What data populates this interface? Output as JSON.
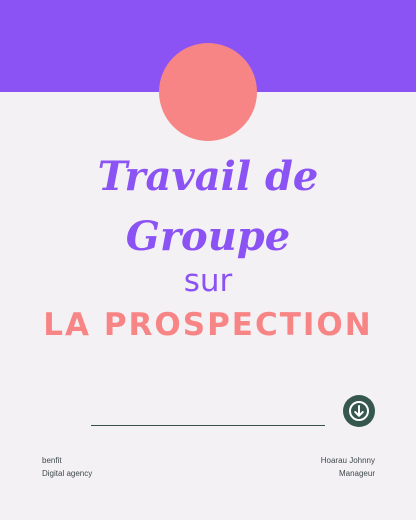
{
  "cover": {
    "title_line1": "Travail de",
    "title_line2": "Groupe",
    "connector": "sur",
    "topic": "LA PROSPECTION"
  },
  "footer": {
    "left_line1": "benfit",
    "left_line2": "Digital agency",
    "right_line1": "Hoarau Johnny",
    "right_line2": "Manageur"
  },
  "icons": {
    "down_button": "arrow-down-icon"
  },
  "colors": {
    "purple": "#8b53f4",
    "coral": "#f88585",
    "background": "#f4f1f4",
    "dark_green": "#35574e"
  }
}
